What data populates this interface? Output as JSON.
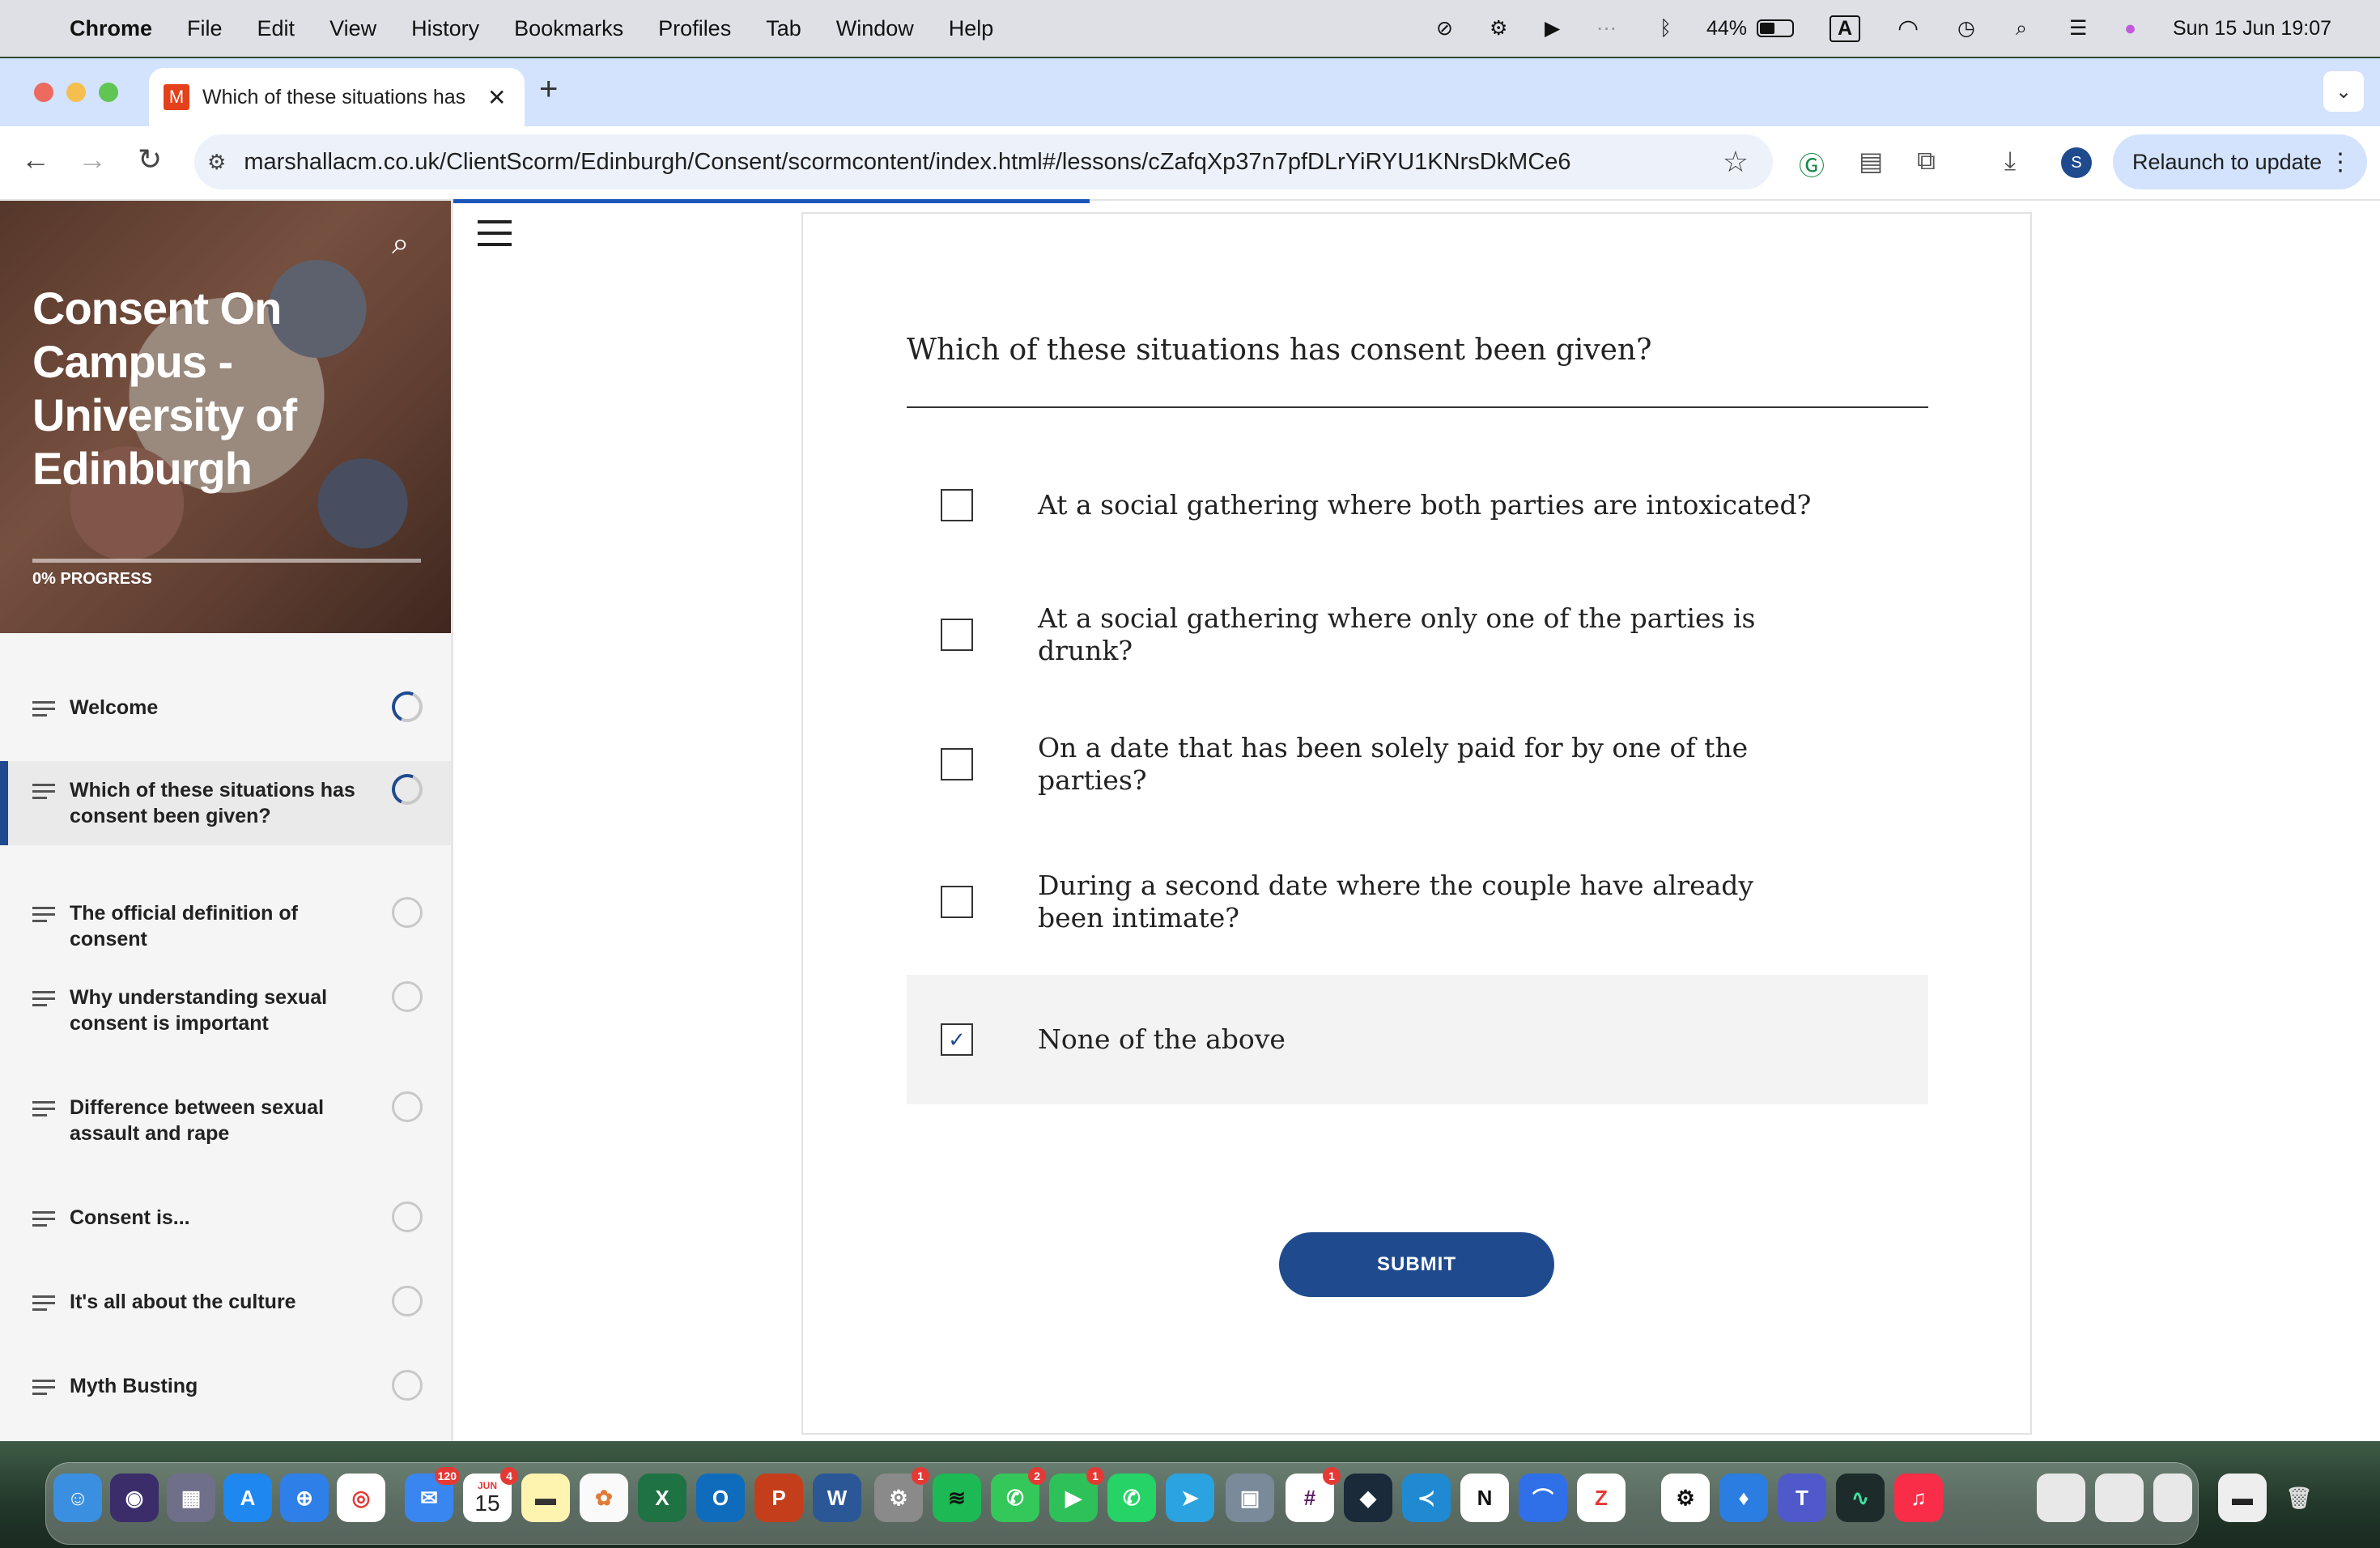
{
  "menubar": {
    "app": "Chrome",
    "items": [
      "File",
      "Edit",
      "View",
      "History",
      "Bookmarks",
      "Profiles",
      "Tab",
      "Window",
      "Help"
    ],
    "battery": "44%",
    "input_source": "A",
    "datetime": "Sun 15 Jun  19:07"
  },
  "browser": {
    "tab_title": "Which of these situations has consent been given?",
    "tab_favicon": "M",
    "url": "marshallacm.co.uk/ClientScorm/Edinburgh/Consent/scormcontent/index.html#/lessons/cZafqXp37n7pfDLrYiRYU1KNrsDkMCe6",
    "profile_initial": "S",
    "relaunch_label": "Relaunch to update"
  },
  "sidebar": {
    "course_title": "Consent On Campus - University of Edinburgh",
    "progress_label": "0% PROGRESS",
    "progress_value": 0,
    "lessons": [
      {
        "title": "Welcome",
        "status": "in-progress"
      },
      {
        "title": "Which of these situations has consent been given?",
        "status": "in-progress"
      },
      {
        "title": "The official definition of consent",
        "status": "not-started"
      },
      {
        "title": "Why understanding sexual consent is important",
        "status": "not-started"
      },
      {
        "title": "Difference between sexual assault and rape",
        "status": "not-started"
      },
      {
        "title": "Consent is...",
        "status": "not-started"
      },
      {
        "title": "It's all about the culture",
        "status": "not-started"
      },
      {
        "title": "Myth Busting",
        "status": "not-started"
      }
    ]
  },
  "quiz": {
    "question": "Which of these situations has consent been given?",
    "options": [
      {
        "text": "At a social gathering where both parties are intoxicated?",
        "checked": false
      },
      {
        "text": "At a social gathering where only one of the parties is drunk?",
        "checked": false
      },
      {
        "text": "On a date that has been solely paid for by one of the parties?",
        "checked": false
      },
      {
        "text": "During a second date where the couple have already been intimate?",
        "checked": false
      },
      {
        "text": "None of the above",
        "checked": true
      }
    ],
    "submit_label": "SUBMIT",
    "accent_color": "#1f4b8e"
  },
  "dock": {
    "calendar_month": "JUN",
    "calendar_day": "15",
    "mail_badge": "120",
    "calendar_badge": "4",
    "prefs_badge": "1",
    "messages_badge": "2",
    "facetime_badge": "1",
    "slack_badge": "1"
  }
}
